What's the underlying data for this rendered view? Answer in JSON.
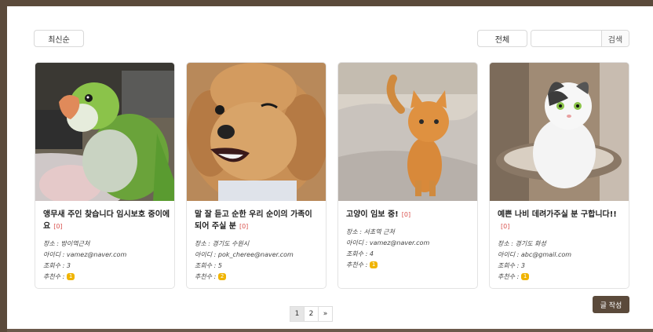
{
  "toolbar": {
    "sort_label": "최신순",
    "filter_label": "전체",
    "search_placeholder": "",
    "search_button": "검색"
  },
  "labels": {
    "location": "장소 : ",
    "user_id": "아이디 : ",
    "views": "조회수 : ",
    "likes": "추천수 : "
  },
  "posts": [
    {
      "title": "앵무새 주인 찾습니다 임시보호 중이에요",
      "comment_count": "[0]",
      "location": "방이역근처",
      "user_id": "vamez@naver.com",
      "views": "3",
      "likes": "1",
      "image_icon": "parrot-photo"
    },
    {
      "title": "말 잘 듣고 순한 우리 순이의 가족이 되어 주실 분",
      "comment_count": "[0]",
      "location": "경기도 수원시",
      "user_id": "pok_cheree@naver.com",
      "views": "5",
      "likes": "2",
      "image_icon": "poodle-photo"
    },
    {
      "title": "고양이 임보 중!",
      "comment_count": "[0]",
      "location": "서초역 근처",
      "user_id": "vamez@naver.com",
      "views": "4",
      "likes": "1",
      "image_icon": "orange-cat-photo"
    },
    {
      "title": "예쁜 나비 데려가주실 분 구합니다!!",
      "comment_count": "[0]",
      "location": "경기도 화성",
      "user_id": "abc@gmail.com",
      "views": "3",
      "likes": "1",
      "image_icon": "white-cat-photo"
    }
  ],
  "pagination": {
    "pages": [
      "1",
      "2"
    ],
    "next": "»",
    "current": "1"
  },
  "write_button": "글 작성",
  "colors": {
    "frame": "#5b4a3b",
    "badge": "#f0b400",
    "comment_count": "#d9534f"
  }
}
